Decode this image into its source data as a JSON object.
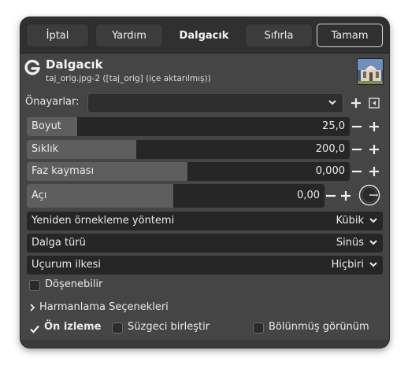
{
  "header": {
    "cancel_label": "İptal",
    "help_label": "Yardım",
    "title": "Dalgacık",
    "reset_label": "Sıfırla",
    "ok_label": "Tamam"
  },
  "plugin": {
    "title": "Dalgacık",
    "subtitle": "taj_orig.jpg-2 ([taj_orig] (içe aktarılmış))",
    "logo_icon": "gimp-g-icon",
    "thumbnail_icon": "image-thumbnail"
  },
  "presets": {
    "label": "Önayarlar:",
    "value": "",
    "add_icon": "plus-icon",
    "menu_icon": "menu-arrow-icon"
  },
  "sliders": [
    {
      "label": "Boyut",
      "value": "25,0",
      "fraction": 0.14
    },
    {
      "label": "Sıklık",
      "value": "200,0",
      "fraction": 0.34
    },
    {
      "label": "Faz kayması",
      "value": "0,000",
      "fraction": 0.5
    },
    {
      "label": "Açı",
      "value": "0,00",
      "fraction": 0.5
    }
  ],
  "combos": [
    {
      "label": "Yeniden örnekleme yöntemi",
      "value": "Kübik"
    },
    {
      "label": "Dalga türü",
      "value": "Sinüs"
    },
    {
      "label": "Uçurum ilkesi",
      "value": "Hiçbiri"
    }
  ],
  "tileable": {
    "label": "Döşenebilir",
    "checked": false
  },
  "blending": {
    "label": "Harmanlama Seçenekleri"
  },
  "footer": {
    "preview_label": "Ön izleme",
    "preview_checked": true,
    "merge_label": "Süzgeci birleştir",
    "merge_checked": false,
    "split_label": "Bölünmüş görünüm",
    "split_checked": false
  }
}
